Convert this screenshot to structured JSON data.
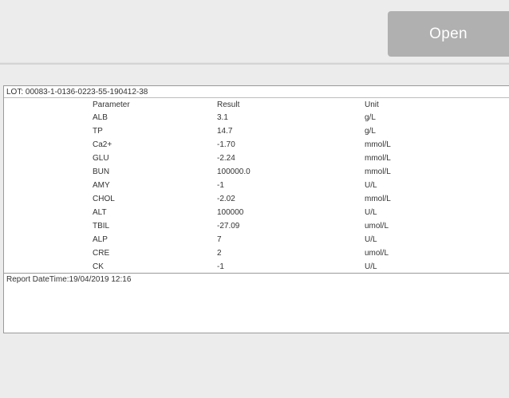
{
  "toolbar": {
    "open_label": "Open"
  },
  "report": {
    "lot": "LOT: 00083-1-0136-0223-55-190412-38",
    "headers": [
      "Parameter",
      "Result",
      "Unit"
    ],
    "rows": [
      [
        "ALB",
        "3.1",
        "g/L"
      ],
      [
        "TP",
        "14.7",
        "g/L"
      ],
      [
        "Ca2+",
        "-1.70",
        "mmol/L"
      ],
      [
        "GLU",
        "-2.24",
        "mmol/L"
      ],
      [
        "BUN",
        "100000.0",
        "mmol/L"
      ],
      [
        "AMY",
        "-1",
        "U/L"
      ],
      [
        "CHOL",
        "-2.02",
        "mmol/L"
      ],
      [
        "ALT",
        "100000",
        "U/L"
      ],
      [
        "TBIL",
        "-27.09",
        "umol/L"
      ],
      [
        "ALP",
        "7",
        "U/L"
      ],
      [
        "CRE",
        "2",
        "umol/L"
      ],
      [
        "CK",
        "-1",
        "U/L"
      ]
    ],
    "report_datetime": "Report DateTime:19/04/2019 12:16"
  }
}
